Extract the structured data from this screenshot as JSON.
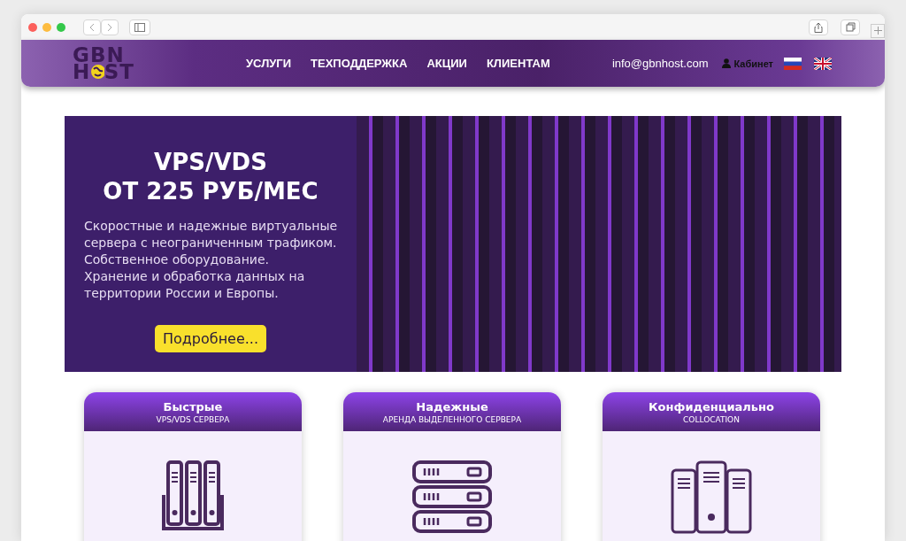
{
  "logo": {
    "line_1": "GBN",
    "line_2_start": "H",
    "line_2_end": "ST"
  },
  "nav": [
    "УСЛУГИ",
    "ТЕХПОДДЕРЖКА",
    "АКЦИИ",
    "КЛИЕНТАМ"
  ],
  "email": "info@gbnhost.com",
  "account": "Кабинет",
  "languages": [
    {
      "kind": "ru"
    },
    {
      "kind": "en"
    }
  ],
  "hero": {
    "title_lines": [
      "VPS/VDS",
      "ОТ 225 РУБ/МЕС"
    ],
    "text_lines": [
      "Скоростные и надежные виртуальные",
      "сервера с неограниченным трафиком.",
      "Собственное оборудование.",
      "Хранение и обработка данных на",
      "территории России и Европы."
    ],
    "button": "Подробнее..."
  },
  "cards": [
    {
      "title": "Быстрые",
      "subtitle": "VPS/VDS СЕРВЕРА",
      "kind": "vps"
    },
    {
      "title": "Надежные",
      "subtitle": "АРЕНДА ВЫДЕЛЕННОГО СЕРВЕРА",
      "kind": "dedicated"
    },
    {
      "title": "Конфиденциально",
      "subtitle": "COLLOCATION",
      "kind": "colocation"
    }
  ]
}
